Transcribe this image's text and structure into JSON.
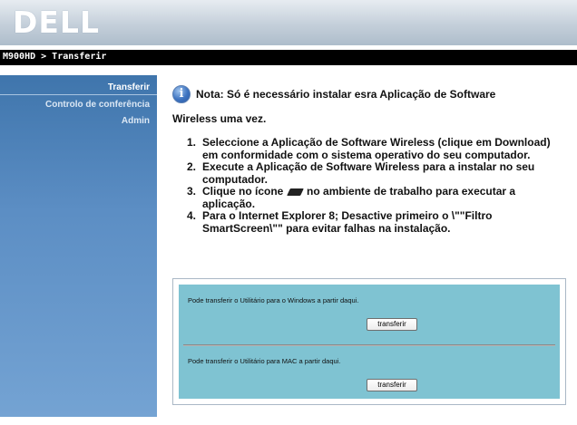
{
  "header": {
    "logo_text": "DELL"
  },
  "breadcrumb": {
    "text": "M900HD > Transferir"
  },
  "sidebar": {
    "items": [
      {
        "label": "Transferir",
        "active": true
      },
      {
        "label": "Controlo de conferência",
        "active": false
      },
      {
        "label": "Admin",
        "active": false
      }
    ]
  },
  "note": {
    "icon": "info-icon",
    "line1": "Nota: Só é necessário instalar esra Aplicação de Software",
    "line2": "Wireless uma vez."
  },
  "steps": [
    {
      "num": "1.",
      "text": "Seleccione a Aplicação de Software Wireless (clique em Download) em conformidade com o sistema operativo do seu computador."
    },
    {
      "num": "2.",
      "text": "Execute a Aplicação de Software Wireless para a instalar no seu computador."
    },
    {
      "num": "3.",
      "text_before": "Clique no ícone",
      "text_after": "no ambiente de trabalho para executar a aplicação.",
      "icon": "projector-shortcut-icon"
    },
    {
      "num": "4.",
      "text": "Para o Internet Explorer 8; Desactive primeiro o \\\"\"Filtro SmartScreen\\\"\" para evitar falhas na instalação."
    }
  ],
  "download": {
    "windows_text": "Pode transferir o Utilitário para o Windows a partir daqui.",
    "windows_button": "transferir",
    "mac_text": "Pode transferir o Utilitário para MAC a partir daqui.",
    "mac_button": "transferir"
  },
  "colors": {
    "sidebar": "#5c8ec4",
    "panel": "#7fc3d2",
    "breadcrumb_bar": "#000000"
  }
}
